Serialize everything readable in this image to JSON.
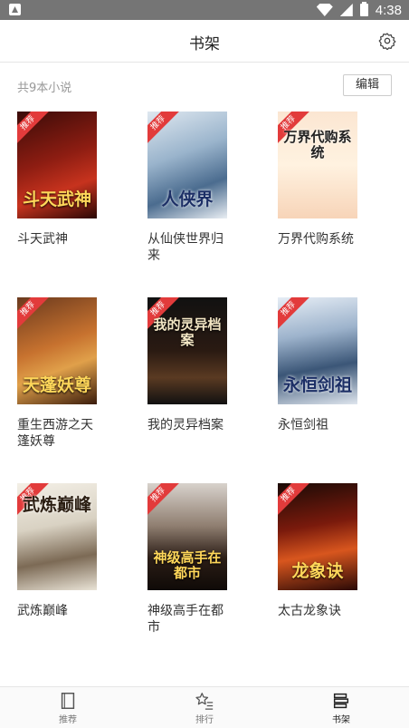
{
  "status_bar": {
    "time": "4:38"
  },
  "header": {
    "title": "书架"
  },
  "shelf": {
    "count_label": "共9本小说",
    "edit_label": "编辑"
  },
  "books": [
    {
      "title": "斗天武神",
      "cover_text": "斗天武神",
      "badge": "推荐"
    },
    {
      "title": "从仙侠世界归来",
      "cover_text": "人侠界",
      "badge": "推荐"
    },
    {
      "title": "万界代购系统",
      "cover_text": "万界代购系统",
      "badge": "推荐"
    },
    {
      "title": "重生西游之天篷妖尊",
      "cover_text": "天蓬妖尊",
      "badge": "推荐"
    },
    {
      "title": "我的灵异档案",
      "cover_text": "我的灵异档案",
      "badge": "推荐"
    },
    {
      "title": "永恒剑祖",
      "cover_text": "永恒剑祖",
      "badge": "推荐"
    },
    {
      "title": "武炼巅峰",
      "cover_text": "武炼巅峰",
      "badge": "推荐"
    },
    {
      "title": "神级高手在都市",
      "cover_text": "神级高手在都市",
      "badge": "推荐"
    },
    {
      "title": "太古龙象诀",
      "cover_text": "龙象诀",
      "badge": "推荐"
    }
  ],
  "bottom_nav": [
    {
      "label": "推荐",
      "icon": "book-icon"
    },
    {
      "label": "排行",
      "icon": "star-list-icon"
    },
    {
      "label": "书架",
      "icon": "shelf-icon",
      "active": true
    }
  ]
}
